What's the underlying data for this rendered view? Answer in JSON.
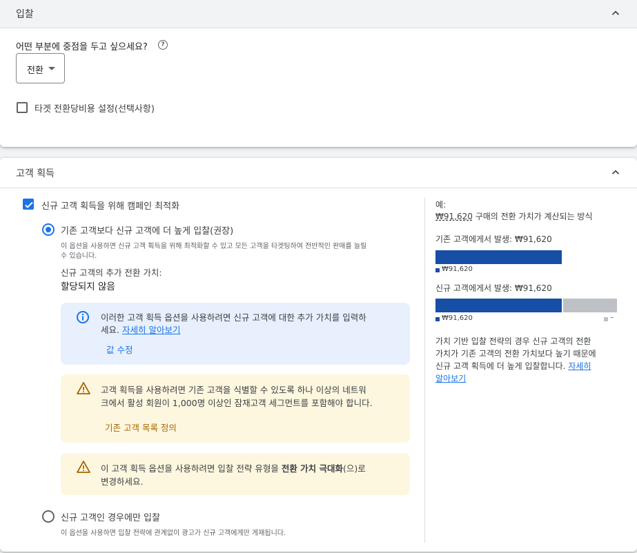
{
  "bidding": {
    "title": "입찰",
    "focus_question": "어떤 부분에 중점을 두고 싶으세요?",
    "focus_select_value": "전환",
    "target_cpa_label": "타겟 전환당비용 설정(선택사항)"
  },
  "acquisition": {
    "title": "고객 획득",
    "optimize_label": "신규 고객 획득을 위해 캠페인 최적화",
    "option1": {
      "label": "기존 고객보다 신규 고객에 더 높게 입찰(권장)",
      "desc_line1": "이 옵션을 사용하면 신규 고객 획득을 위해 최적화할 수 있고 모든 고객을 타겟팅하여 전반적인 판매를 늘릴",
      "desc_line2": "수 있습니다.",
      "extra_value_label": "신규 고객의 추가 전환 가치:",
      "extra_value": "할당되지 않음"
    },
    "info_box": {
      "line1": "이러한 고객 획득 옵션을 사용하려면 신규 고객에 대한 추가 가치를 입력하",
      "line2_prefix": "세요.",
      "learn_more": "자세히 알아보기",
      "action": "값 수정"
    },
    "warning_box1": {
      "line1": "고객 획득을 사용하려면 기존 고객을 식별할 수 있도록 하나 이상의 네트워",
      "line2": "크에서 활성 회원이 1,000명 이상인 잠재고객 세그먼트를 포함해야 합니다.",
      "action": "기존 고객 목록 정의"
    },
    "warning_box2": {
      "line1_prefix": "이 고객 획득 옵션을 사용하려면 입찰 전략 유형을",
      "line1_bold": "전환 가치 극대화",
      "line1_suffix": "(으)로",
      "line2": "변경하세요."
    },
    "option2": {
      "label": "신규 고객인 경우에만 입찰",
      "desc": "이 옵션을 사용하면 입찰 전략에 관계없이 광고가 신규 고객에게만 게재됩니다."
    },
    "example": {
      "heading": "예:",
      "amount": "₩91,620",
      "amount_suffix": "구매의 전환 가치가 계산되는 방식",
      "existing_label": "기존 고객에게서 발생: ₩91,620",
      "existing_bar_value": "₩91,620",
      "new_label": "신규 고객에게서 발생: ₩91,620",
      "new_bar_value": "₩91,620",
      "new_extra_value": "–",
      "explain_line1": "가치 기반 입찰 전략의 경우 신규 고객의 전환",
      "explain_line2": "가치가 기존 고객의 전환 가치보다 높기 때문에",
      "explain_line3_prefix": "신규 고객 획득에 더 높게 입찰합니다.",
      "explain_line3_link": "자세히",
      "explain_line4_link": "알아보기",
      "colors": {
        "base": "#174ea6",
        "extra": "#bdc1c6"
      }
    }
  }
}
